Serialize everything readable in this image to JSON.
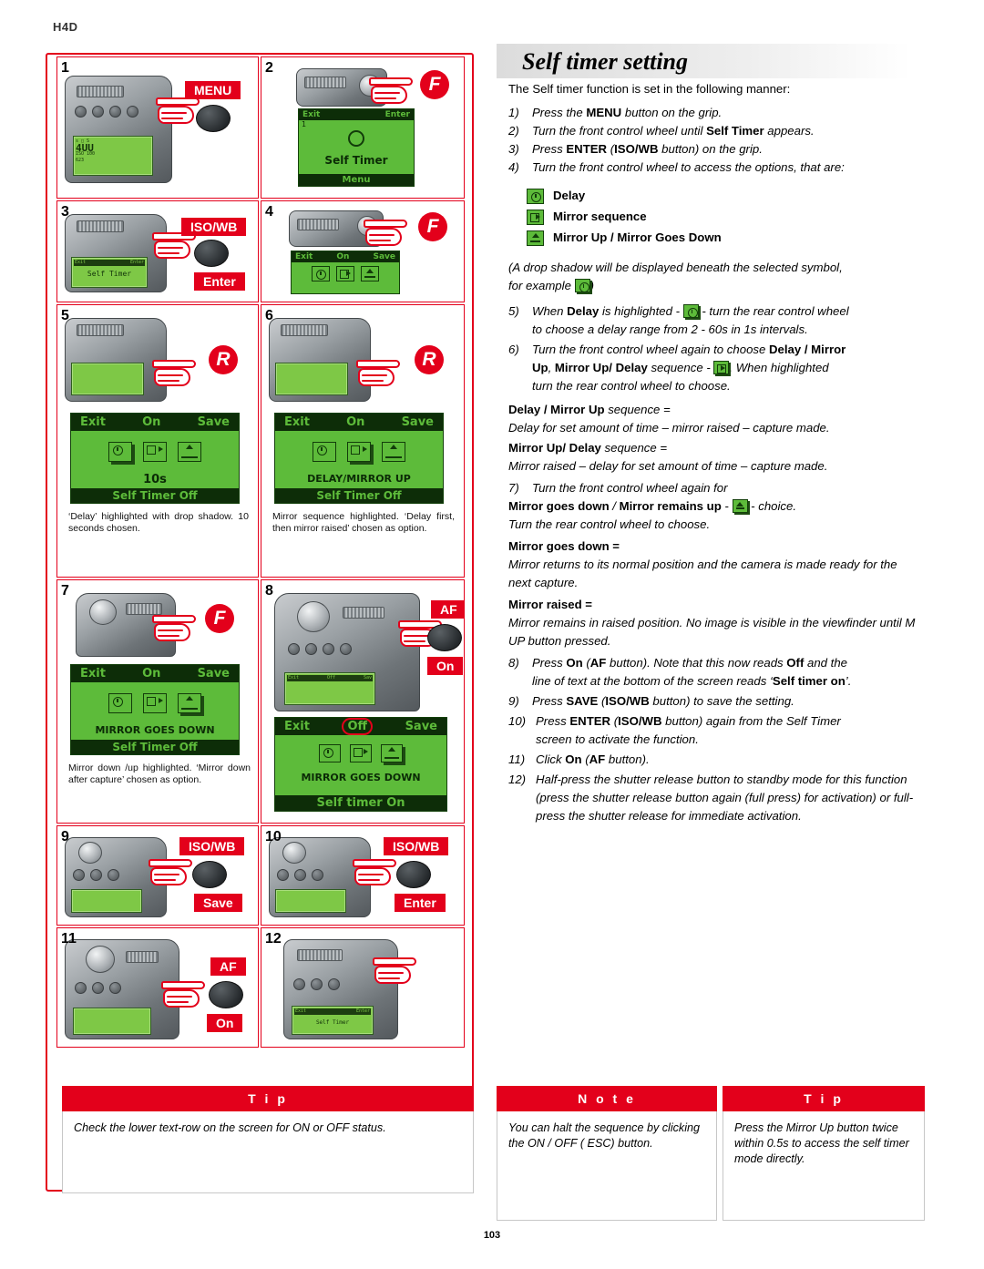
{
  "header": {
    "model": "H4D",
    "page_number": "103"
  },
  "title": "Self timer setting",
  "intro": "The Self timer function is set in the following manner:",
  "steps_text": [
    {
      "n": "1)",
      "html": "Press the MENU button on the grip."
    },
    {
      "n": "2)",
      "html": "Turn the front control wheel until Self Timer appears."
    },
    {
      "n": "3)",
      "html": "Press ENTER (ISO/WB button) on the grip."
    },
    {
      "n": "4)",
      "html": "Turn the front control wheel to access the options, that are:"
    }
  ],
  "options": [
    {
      "icon": "clock-icon",
      "label": "Delay"
    },
    {
      "icon": "mirror-sequence-icon",
      "label": "Mirror sequence"
    },
    {
      "icon": "mirror-up-down-icon",
      "label": "Mirror Up / Mirror Goes Down"
    }
  ],
  "drop_shadow_note_a": "(A drop shadow will be displayed beneath the selected symbol,",
  "drop_shadow_note_b": "for example",
  "drop_shadow_note_c": ")",
  "step5_a": "5)",
  "step5_b1": "When ",
  "step5_b2": "Delay",
  "step5_b3": " is highlighted - ",
  "step5_b4": " - turn the rear control wheel",
  "step5_c": "to choose a delay range from 2 - 60s in 1s intervals.",
  "step6_a": "6)",
  "step6_b1": "Turn the front control wheel again to choose ",
  "step6_b2": "Delay / Mirror",
  "step6_c1": "Up",
  "step6_c2": ", ",
  "step6_c3": "Mirror Up/ Delay",
  "step6_c4": " sequence - ",
  "step6_c5": ". When highlighted",
  "step6_d": "turn the rear control wheel to choose.",
  "defs": [
    {
      "term": "Delay / Mirror Up",
      "term_suffix": " sequence =",
      "desc": "Delay for set amount of time – mirror raised – capture made."
    },
    {
      "term": "Mirror Up/ Delay",
      "term_suffix": " sequence =",
      "desc": "Mirror raised – delay for set amount of time – capture made."
    }
  ],
  "step7_a": "7)",
  "step7_b": "Turn the front control wheel again for",
  "step7_c1": "Mirror goes down",
  "step7_c2": " / ",
  "step7_c3": "Mirror remains up",
  "step7_c4": " - ",
  "step7_c5": " - choice.",
  "step7_d": "Turn the rear control wheel to choose.",
  "defs2": [
    {
      "term": "Mirror goes down =",
      "desc": "Mirror returns to its normal position and the camera is made ready for the next capture."
    },
    {
      "term": "Mirror raised =",
      "desc": "Mirror remains in raised position. No image is visible in the viewfinder until M UP button pressed."
    }
  ],
  "step8_a": "8)",
  "step8_b1": "Press ",
  "step8_b2": "On",
  "step8_b3": " (",
  "step8_b4": "AF",
  "step8_b5": " button). Note that this now reads ",
  "step8_b6": "Off",
  "step8_b7": " and the",
  "step8_c1": "line of text at the bottom of the screen reads ‘",
  "step8_c2": "Self timer on",
  "step8_c3": "’.",
  "step9_a": "9)",
  "step9_b1": "Press ",
  "step9_b2": "SAVE",
  "step9_b3": " (",
  "step9_b4": "ISO/WB",
  "step9_b5": " button) to save the setting.",
  "step10_a": "10)",
  "step10_b1": "Press ",
  "step10_b2": "ENTER",
  "step10_b3": " (",
  "step10_b4": "ISO/WB",
  "step10_b5": " button) again from the Self Timer",
  "step10_c": "screen to activate the function.",
  "step11_a": "11)",
  "step11_b1": "Click ",
  "step11_b2": "On",
  "step11_b3": " (",
  "step11_b4": "AF",
  "step11_b5": " button).",
  "step12_a": "12)",
  "step12_b": "Half-press the shutter release button to standby mode for this function (press the shutter release button again (full press) for activation) or full-press the shutter release for immediate activation.",
  "panels": [
    {
      "num": "1",
      "chip": "MENU",
      "chip_type": "red-dark",
      "badge": "",
      "lcd_lines": [
        "s □ S",
        "4UU",
        "ISO 100",
        "623"
      ]
    },
    {
      "num": "2",
      "chip": "",
      "badge": "F",
      "scr_top_left": "Exit",
      "scr_top_right": "Enter",
      "scr_center": "Self Timer",
      "scr_bottom": "Menu"
    },
    {
      "num": "3",
      "chip": "ISO/WB",
      "chip2": "Enter",
      "badge": ""
    },
    {
      "num": "4",
      "chip": "",
      "badge": "F"
    },
    {
      "num": "5",
      "badge": "R",
      "scr_top": [
        "Exit",
        "On",
        "Save"
      ],
      "scr_val": "10s",
      "scr_bottom": "Self Timer Off",
      "caption": "‘Delay’ highlighted with drop shadow. 10 seconds chosen."
    },
    {
      "num": "6",
      "badge": "R",
      "scr_top": [
        "Exit",
        "On",
        "Save"
      ],
      "scr_val": "DELAY/MIRROR UP",
      "scr_bottom": "Self Timer Off",
      "caption": "Mirror sequence highlighted. ‘Delay first, then mirror raised’ chosen as option."
    },
    {
      "num": "7",
      "badge": "F",
      "scr_top": [
        "Exit",
        "On",
        "Save"
      ],
      "scr_val": "MIRROR GOES DOWN",
      "scr_bottom": "Self Timer Off",
      "caption": "Mirror down /up highlighted. ‘Mirror down after capture’ chosen as option."
    },
    {
      "num": "8",
      "chip": "On",
      "chip_label": "AF",
      "scr_top": [
        "Exit",
        "Off",
        "Save"
      ],
      "scr_val": "MIRROR GOES DOWN",
      "scr_bottom": "Self timer On"
    },
    {
      "num": "9",
      "chip": "ISO/WB",
      "chip2": "Save"
    },
    {
      "num": "10",
      "chip": "ISO/WB",
      "chip2": "Enter"
    },
    {
      "num": "11",
      "chip_label": "AF",
      "chip2": "On"
    },
    {
      "num": "12",
      "chip": ""
    }
  ],
  "boxes": [
    {
      "kind": "Tip",
      "title": "T i p",
      "text": "Check the lower text-row on the screen for ON or OFF status."
    },
    {
      "kind": "Note",
      "title": "N o t e",
      "text": "You can halt the sequence by clicking the ON / OFF ( ESC) button."
    },
    {
      "kind": "Tip",
      "title": "T i p",
      "text": "Press the Mirror Up button twice within 0.5s to access the self timer mode directly."
    }
  ],
  "colors": {
    "accent_red": "#e3001b",
    "lcd_green": "#5dbb3a",
    "lcd_dark": "#0d2d08"
  }
}
